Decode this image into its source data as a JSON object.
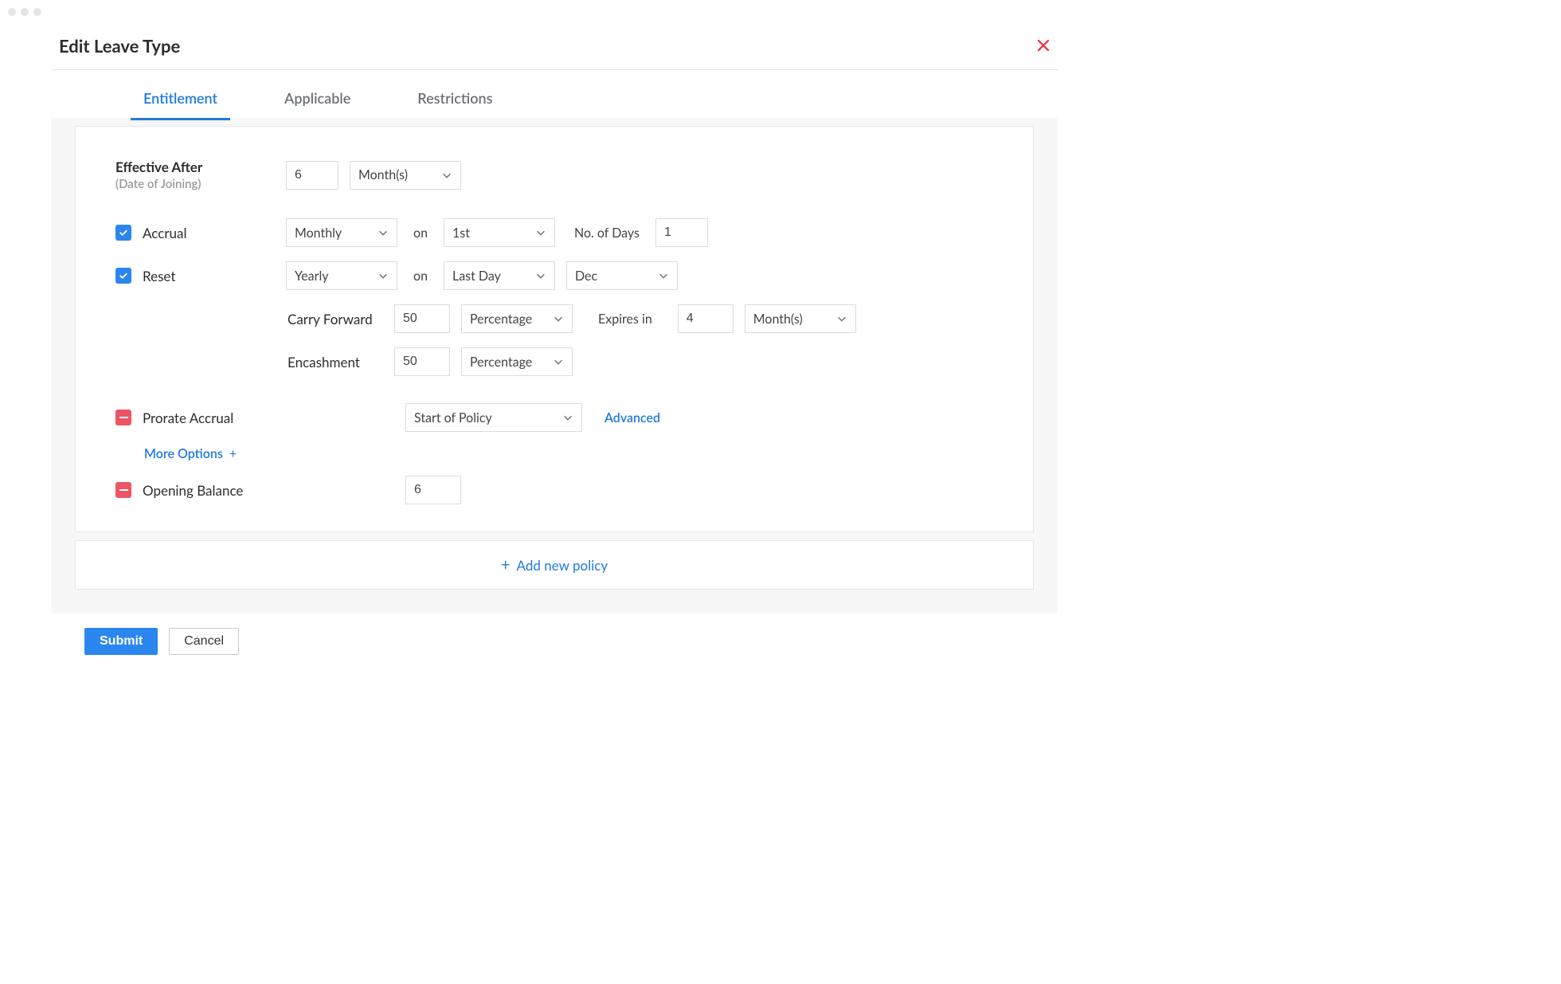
{
  "header": {
    "title": "Edit Leave Type"
  },
  "tabs": {
    "entitlement": "Entitlement",
    "applicable": "Applicable",
    "restrictions": "Restrictions"
  },
  "labels": {
    "effective_after": "Effective After",
    "effective_after_sub": "(Date of Joining)",
    "accrual": "Accrual",
    "reset": "Reset",
    "on": "on",
    "no_of_days": "No. of Days",
    "carry_forward": "Carry Forward",
    "encashment": "Encashment",
    "expires_in": "Expires in",
    "prorate_accrual": "Prorate Accrual",
    "advanced": "Advanced",
    "more_options": "More Options",
    "opening_balance": "Opening Balance",
    "add_new_policy": "Add new policy"
  },
  "values": {
    "effective_after_value": "6",
    "effective_after_unit": "Month(s)",
    "accrual_freq": "Monthly",
    "accrual_day": "1st",
    "accrual_days": "1",
    "reset_freq": "Yearly",
    "reset_day": "Last Day",
    "reset_month": "Dec",
    "carry_forward_value": "50",
    "carry_forward_unit": "Percentage",
    "expires_value": "4",
    "expires_unit": "Month(s)",
    "encashment_value": "50",
    "encashment_unit": "Percentage",
    "prorate_value": "Start of Policy",
    "opening_balance_value": "6"
  },
  "checks": {
    "accrual": true,
    "reset": true,
    "prorate": "minus",
    "opening_balance": "minus"
  },
  "footer": {
    "submit": "Submit",
    "cancel": "Cancel"
  }
}
